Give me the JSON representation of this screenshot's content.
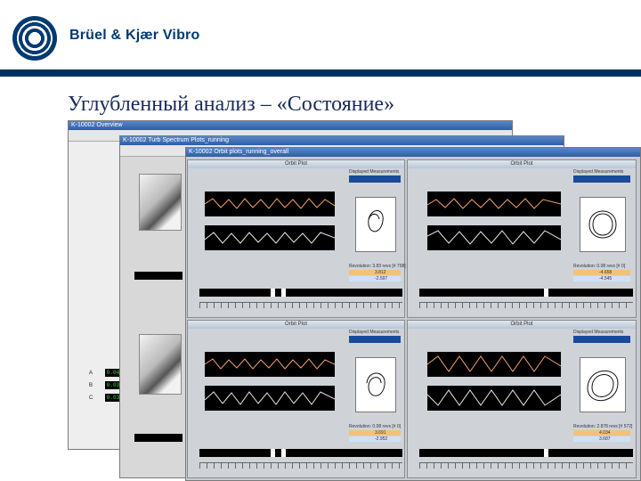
{
  "brand": {
    "name": "Brüel & Kjær Vibro"
  },
  "slide": {
    "title": "Углубленный анализ – «Состояние»"
  },
  "windows": {
    "overview": "K-10002 Overview",
    "spectrum": "K-10002 Turb Spectrum Plots_running",
    "orbit": "K-10002 Orbit plots_running_overall"
  },
  "orbit_panels": [
    {
      "title": "Orbit Plot",
      "meas": "Displayed Measurements",
      "rev": "Revolution: 3.83 revs [# 798]",
      "v1": "3.812",
      "v2": "-2.597",
      "unit": "µm"
    },
    {
      "title": "Orbit Plot",
      "meas": "Displayed Measurements",
      "rev": "Revolution: 0.08 revs [# 0]",
      "v1": "-4.658",
      "v2": "-4.545",
      "unit": "µm"
    },
    {
      "title": "Orbit Plot",
      "meas": "Displayed Measurements",
      "rev": "Revolution: 0.08 revs [# 0]",
      "v1": "3.691",
      "v2": "-2.952",
      "unit": "µm"
    },
    {
      "title": "Orbit Plot",
      "meas": "Displayed Measurements",
      "rev": "Revolution: 2.878 revs [# 572]",
      "v1": "4.034",
      "v2": "3.687",
      "unit": "µm"
    }
  ],
  "overview_labels": [
    {
      "letter": "A",
      "value": "0.04"
    },
    {
      "letter": "B",
      "value": "0.03"
    },
    {
      "letter": "C",
      "value": "0.03"
    }
  ],
  "colors": {
    "title_bar": "#2c5ea8",
    "header_rule": "#002f63",
    "value_highlight": "#f4c07a"
  }
}
